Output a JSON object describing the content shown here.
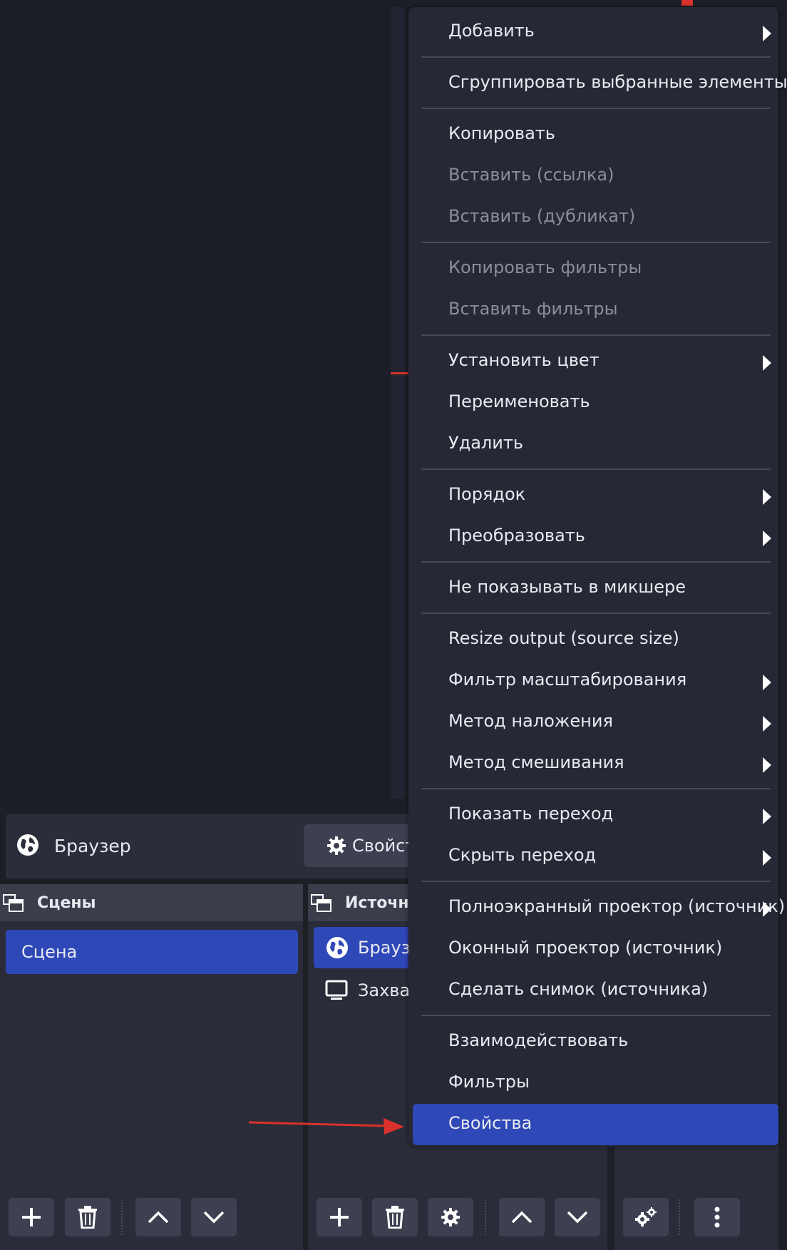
{
  "context_bar": {
    "source_name": "Браузер",
    "properties_label": "Свойства"
  },
  "scenes_dock": {
    "title": "Сцены",
    "items": [
      "Сцена"
    ]
  },
  "sources_dock": {
    "title": "Источники",
    "items": [
      {
        "name": "Браузер",
        "icon": "globe-icon"
      },
      {
        "name": "Захват",
        "icon": "monitor-icon"
      }
    ]
  },
  "context_menu": {
    "items": [
      {
        "label": "Добавить",
        "submenu": true,
        "disabled": false
      },
      {
        "label": "Сгруппировать выбранные элементы",
        "submenu": false,
        "disabled": false
      },
      {
        "label": "Копировать",
        "submenu": false,
        "disabled": false
      },
      {
        "label": "Вставить (ссылка)",
        "submenu": false,
        "disabled": true
      },
      {
        "label": "Вставить (дубликат)",
        "submenu": false,
        "disabled": true
      },
      {
        "label": "Копировать фильтры",
        "submenu": false,
        "disabled": true
      },
      {
        "label": "Вставить фильтры",
        "submenu": false,
        "disabled": true
      },
      {
        "label": "Установить цвет",
        "submenu": true,
        "disabled": false
      },
      {
        "label": "Переименовать",
        "submenu": false,
        "disabled": false
      },
      {
        "label": "Удалить",
        "submenu": false,
        "disabled": false
      },
      {
        "label": "Порядок",
        "submenu": true,
        "disabled": false
      },
      {
        "label": "Преобразовать",
        "submenu": true,
        "disabled": false
      },
      {
        "label": "Не показывать в микшере",
        "submenu": false,
        "disabled": false
      },
      {
        "label": "Resize output (source size)",
        "submenu": false,
        "disabled": false
      },
      {
        "label": "Фильтр масштабирования",
        "submenu": true,
        "disabled": false
      },
      {
        "label": "Метод наложения",
        "submenu": true,
        "disabled": false
      },
      {
        "label": "Метод смешивания",
        "submenu": true,
        "disabled": false
      },
      {
        "label": "Показать переход",
        "submenu": true,
        "disabled": false
      },
      {
        "label": "Скрыть переход",
        "submenu": true,
        "disabled": false
      },
      {
        "label": "Полноэкранный проектор (источник)",
        "submenu": true,
        "disabled": false
      },
      {
        "label": "Оконный проектор (источник)",
        "submenu": false,
        "disabled": false
      },
      {
        "label": "Сделать снимок (источника)",
        "submenu": false,
        "disabled": false
      },
      {
        "label": "Взаимодействовать",
        "submenu": false,
        "disabled": false
      },
      {
        "label": "Фильтры",
        "submenu": false,
        "disabled": false
      },
      {
        "label": "Свойства",
        "submenu": false,
        "disabled": false,
        "selected": true
      }
    ]
  },
  "colors": {
    "accent": "#2e48b8",
    "annotation_arrow": "#d9312b",
    "menu_bg": "#262935",
    "disabled_text": "#8a8e9b"
  }
}
